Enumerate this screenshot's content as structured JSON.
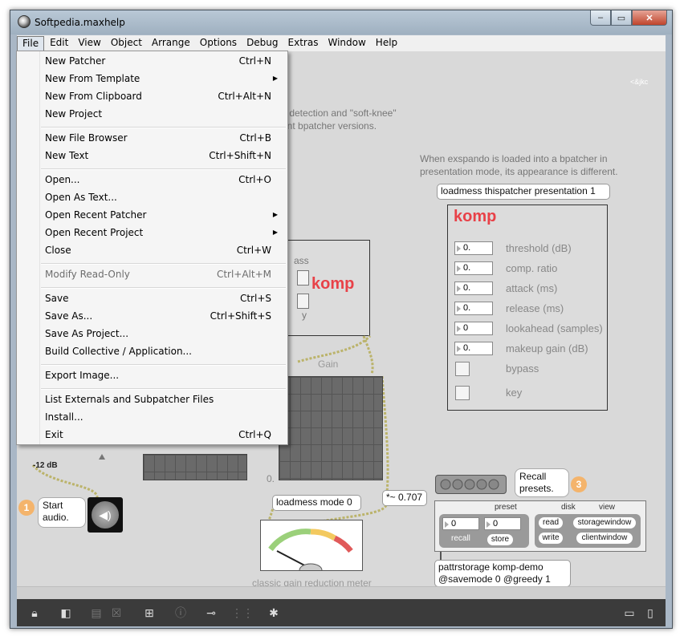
{
  "window": {
    "title": "Softpedia.maxhelp",
    "minimize": "‒",
    "maximize": "▭",
    "close": "✕"
  },
  "menubar": [
    "File",
    "Edit",
    "View",
    "Object",
    "Arrange",
    "Options",
    "Debug",
    "Extras",
    "Window",
    "Help"
  ],
  "file_menu": [
    {
      "label": "New Patcher",
      "shortcut": "Ctrl+N"
    },
    {
      "label": "New From Template",
      "shortcut": "",
      "submenu": true
    },
    {
      "label": "New From Clipboard",
      "shortcut": "Ctrl+Alt+N"
    },
    {
      "label": "New Project",
      "shortcut": ""
    },
    {
      "label": "New File Browser",
      "shortcut": "Ctrl+B"
    },
    {
      "label": "New Text",
      "shortcut": "Ctrl+Shift+N"
    },
    {
      "label": "Open...",
      "shortcut": "Ctrl+O"
    },
    {
      "label": "Open As Text...",
      "shortcut": ""
    },
    {
      "label": "Open Recent Patcher",
      "shortcut": "",
      "submenu": true
    },
    {
      "label": "Open Recent Project",
      "shortcut": "",
      "submenu": true
    },
    {
      "label": "Close",
      "shortcut": "Ctrl+W"
    },
    {
      "label": "Modify Read-Only",
      "shortcut": "Ctrl+Alt+M",
      "disabled": true
    },
    {
      "label": "Save",
      "shortcut": "Ctrl+S"
    },
    {
      "label": "Save As...",
      "shortcut": "Ctrl+Shift+S"
    },
    {
      "label": "Save As Project...",
      "shortcut": ""
    },
    {
      "label": "Build Collective / Application...",
      "shortcut": ""
    },
    {
      "label": "Export Image...",
      "shortcut": ""
    },
    {
      "label": "List Externals and Subpatcher Files",
      "shortcut": ""
    },
    {
      "label": "Install...",
      "shortcut": ""
    },
    {
      "label": "Exit",
      "shortcut": "Ctrl+Q"
    }
  ],
  "patcher": {
    "credit": "<&jkc",
    "desc_line1": "s detection and \"soft-knee\"",
    "desc_line2": "ent bpatcher versions.",
    "note_line1": "When exspando is loaded into a bpatcher in",
    "note_line2": "presentation mode, its appearance is different.",
    "loadmess_presentation": "loadmess thispatcher presentation 1",
    "komp_title": "komp",
    "komp_small_title": "komp",
    "params": [
      {
        "value": "0.",
        "label": "threshold (dB)"
      },
      {
        "value": "0.",
        "label": "comp. ratio"
      },
      {
        "value": "0.",
        "label": "attack (ms)"
      },
      {
        "value": "0.",
        "label": "release (ms)"
      },
      {
        "value": "0",
        "label": "lookahead (samples)"
      },
      {
        "value": "0.",
        "label": "makeup gain (dB)"
      }
    ],
    "bypass_label": "bypass",
    "key_label": "key",
    "small_bypass_fragment": "ass",
    "small_y_fragment": "y",
    "gain_label": "Gain",
    "db_label": "-12 dB",
    "zero_label": "0.",
    "loadmess_mode": "loadmess mode 0",
    "line_obj": "*~ 0.707",
    "meter_caption": "classic gain reduction meter",
    "start_audio_step": "1",
    "start_audio_line1": "Start",
    "start_audio_line2": "audio.",
    "recall_step": "3",
    "recall_line1": "Recall",
    "recall_line2": "presets.",
    "preset_header": "preset",
    "disk_header": "disk",
    "view_header": "view",
    "preset_val1": "0",
    "preset_val2": "0",
    "recall_btn": "recall",
    "store_btn": "store",
    "read_btn": "read",
    "write_btn": "write",
    "storagewindow_btn": "storagewindow",
    "clientwindow_btn": "clientwindow",
    "pattr_line1": "pattrstorage komp-demo",
    "pattr_line2": "@savemode 0 @greedy 1"
  },
  "colors": {
    "komp_red": "#e84148",
    "badge_orange": "#f4b46c"
  }
}
